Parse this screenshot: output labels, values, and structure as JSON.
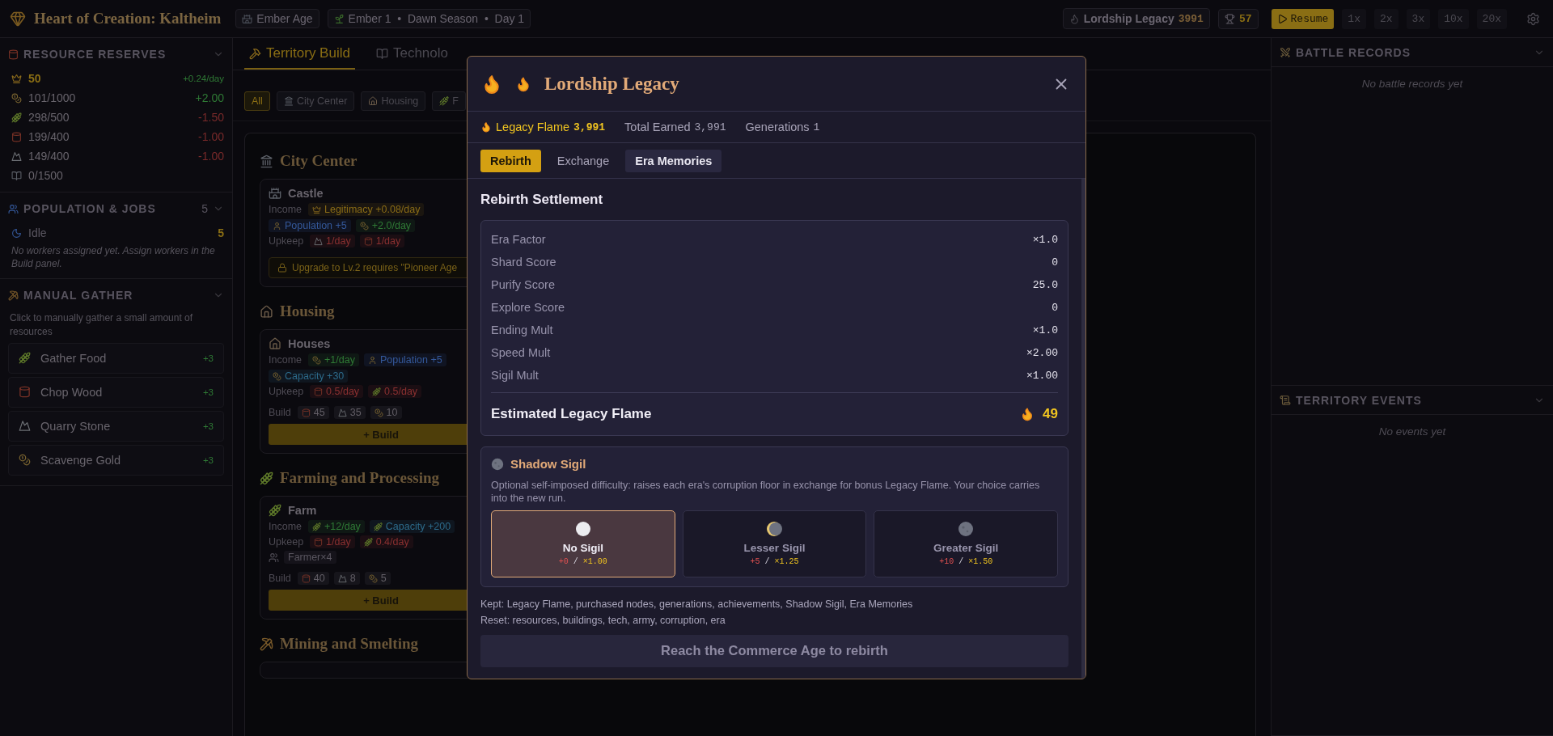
{
  "topbar": {
    "title": "Heart of Creation: Kaltheim",
    "age": "Ember Age",
    "date": "Ember 1  •  Dawn Season  •  Day 1",
    "legacy": {
      "label": "Lordship Legacy",
      "value": "3991"
    },
    "trophies": "57",
    "resume": "Resume",
    "speeds": [
      {
        "label": "1x",
        "selected": false
      },
      {
        "label": "2x",
        "selected": false
      },
      {
        "label": "3x",
        "selected": false
      },
      {
        "label": "10x",
        "selected": false
      },
      {
        "label": "20x",
        "selected": false
      }
    ]
  },
  "resources": {
    "title": "RESOURCE RESERVES",
    "items": [
      {
        "kind": "legitimacy",
        "value": "50",
        "rate": "+0.24/day",
        "color": "#2f7a35"
      },
      {
        "kind": "gold",
        "value": "101/1000",
        "rate": "+2.00",
        "color": "#2f7a35"
      },
      {
        "kind": "food",
        "value": "298/500",
        "rate": "-1.50",
        "color": "#7a2a2a"
      },
      {
        "kind": "wood",
        "value": "199/400",
        "rate": "-1.00",
        "color": "#7a2a2a"
      },
      {
        "kind": "stone",
        "value": "149/400",
        "rate": "-1.00",
        "color": "#7a2a2a"
      },
      {
        "kind": "knowledge",
        "value": "0/1500"
      }
    ]
  },
  "population": {
    "title": "POPULATION & JOBS",
    "count": "5",
    "idle_label": "Idle",
    "idle_count": "5",
    "note": "No workers assigned yet. Assign workers in the Build panel."
  },
  "gather": {
    "title": "MANUAL GATHER",
    "note": "Click to manually gather a small amount of resources",
    "actions": [
      {
        "kind": "food",
        "label": "Gather Food",
        "gain": "+3"
      },
      {
        "kind": "wood",
        "label": "Chop Wood",
        "gain": "+3"
      },
      {
        "kind": "stone",
        "label": "Quarry Stone",
        "gain": "+3"
      },
      {
        "kind": "gold",
        "label": "Scavenge Gold",
        "gain": "+3"
      }
    ]
  },
  "center": {
    "tabs": [
      {
        "kind": "build",
        "label": "Territory Build",
        "selected": true
      },
      {
        "kind": "tech",
        "label": "Technolo",
        "selected": false
      }
    ],
    "filters": [
      {
        "label": "All",
        "selected": true
      },
      {
        "kind": "city",
        "label": "City Center",
        "selected": false
      },
      {
        "kind": "housing",
        "label": "Housing",
        "selected": false
      },
      {
        "kind": "food",
        "label": "F",
        "selected": false
      }
    ],
    "sections": [
      {
        "kind": "city",
        "title": "City Center",
        "buildings": [
          {
            "kind": "castle",
            "name": "Castle",
            "income_label": "Income",
            "income": [
              {
                "kind": "legitimacy",
                "text": "Legitimacy +0.08/day",
                "color": "#8a6c16"
              },
              {
                "kind": "population",
                "text": "Population +5",
                "color": "#34589a"
              },
              {
                "kind": "gold",
                "text": "+2.0/day",
                "color": "#2f7a35"
              }
            ],
            "upkeep_label": "Upkeep",
            "upkeep": [
              {
                "kind": "stone",
                "text": "1/day"
              },
              {
                "kind": "wood",
                "text": "1/day"
              }
            ],
            "locked": "Upgrade to Lv.2 requires \"Pioneer Age"
          }
        ]
      },
      {
        "kind": "housing",
        "title": "Housing",
        "buildings": [
          {
            "kind": "housing",
            "name": "Houses",
            "income_label": "Income",
            "income": [
              {
                "kind": "gold",
                "text": "+1/day",
                "color": "#2f7a35"
              },
              {
                "kind": "population",
                "text": "Population +5",
                "color": "#34589a"
              },
              {
                "kind": "gold",
                "text": "Capacity +30",
                "color": "#2c6a8a"
              }
            ],
            "upkeep_label": "Upkeep",
            "upkeep": [
              {
                "kind": "wood",
                "text": "0.5/day"
              },
              {
                "kind": "food",
                "text": "0.5/day"
              }
            ],
            "cost_label": "Build",
            "cost": [
              {
                "kind": "wood",
                "text": "45"
              },
              {
                "kind": "stone",
                "text": "35"
              },
              {
                "kind": "gold",
                "text": "10"
              }
            ],
            "build": "+ Build"
          }
        ]
      },
      {
        "kind": "food",
        "title": "Farming and Processing",
        "buildings": [
          {
            "kind": "food",
            "name": "Farm",
            "income_label": "Income",
            "income": [
              {
                "kind": "food",
                "text": "+12/day",
                "color": "#2f7a35"
              },
              {
                "kind": "food",
                "text": "Capacity +200",
                "color": "#2c6a8a"
              }
            ],
            "upkeep_label": "Upkeep",
            "upkeep": [
              {
                "kind": "wood",
                "text": "1/day"
              },
              {
                "kind": "food",
                "text": "0.4/day"
              }
            ],
            "workers": "Farmer×4",
            "cost_label": "Build",
            "cost": [
              {
                "kind": "wood",
                "text": "40"
              },
              {
                "kind": "stone",
                "text": "8"
              },
              {
                "kind": "gold",
                "text": "5"
              }
            ],
            "build": "+ Build"
          }
        ]
      },
      {
        "kind": "mining",
        "title": "Mining and Smelting"
      }
    ]
  },
  "battle": {
    "title": "BATTLE RECORDS",
    "empty": "No battle records yet"
  },
  "events": {
    "title": "TERRITORY EVENTS",
    "empty": "No events yet"
  },
  "modal": {
    "title": "Lordship Legacy",
    "stats": [
      {
        "kind": "flame",
        "label": "Legacy Flame",
        "value": "3,991"
      },
      {
        "kind": "plain",
        "label": "Total Earned",
        "value": "3,991"
      },
      {
        "kind": "plain",
        "label": "Generations",
        "value": "1"
      }
    ],
    "tabs": [
      {
        "label": "Rebirth",
        "selected": true,
        "hovered": false
      },
      {
        "label": "Exchange",
        "selected": false,
        "hovered": false
      },
      {
        "label": "Era Memories",
        "selected": false,
        "hovered": true
      }
    ],
    "settlement": {
      "title": "Rebirth Settlement",
      "rows": [
        {
          "label": "Era Factor",
          "value": "×1.0"
        },
        {
          "label": "Shard Score",
          "value": "0"
        },
        {
          "label": "Purify Score",
          "value": "25.0"
        },
        {
          "label": "Explore Score",
          "value": "0"
        },
        {
          "label": "Ending Mult",
          "value": "×1.0"
        },
        {
          "label": "Speed Mult",
          "value": "×2.00"
        },
        {
          "label": "Sigil Mult",
          "value": "×1.00"
        }
      ],
      "total_label": "Estimated Legacy Flame",
      "total_value": "49"
    },
    "sigil": {
      "title": "Shadow Sigil",
      "description": "Optional self-imposed difficulty: raises each era's corruption floor in exchange for bonus Legacy Flame. Your choice carries into the new run.",
      "options": [
        {
          "kind": "none",
          "name": "No Sigil",
          "floor": "+0",
          "separator": "/",
          "mult": "×1.00",
          "selected": true
        },
        {
          "kind": "lesser",
          "name": "Lesser Sigil",
          "floor": "+5",
          "separator": "/",
          "mult": "×1.25",
          "selected": false
        },
        {
          "kind": "greater",
          "name": "Greater Sigil",
          "floor": "+10",
          "separator": "/",
          "mult": "×1.50",
          "selected": false
        }
      ]
    },
    "kept": "Kept: Legacy Flame, purchased nodes, generations, achievements, Shadow Sigil, Era Memories",
    "reset": "Reset: resources, buildings, tech, army, corruption, era",
    "action": {
      "label": "Reach the Commerce Age to rebirth",
      "disabled": true
    }
  }
}
